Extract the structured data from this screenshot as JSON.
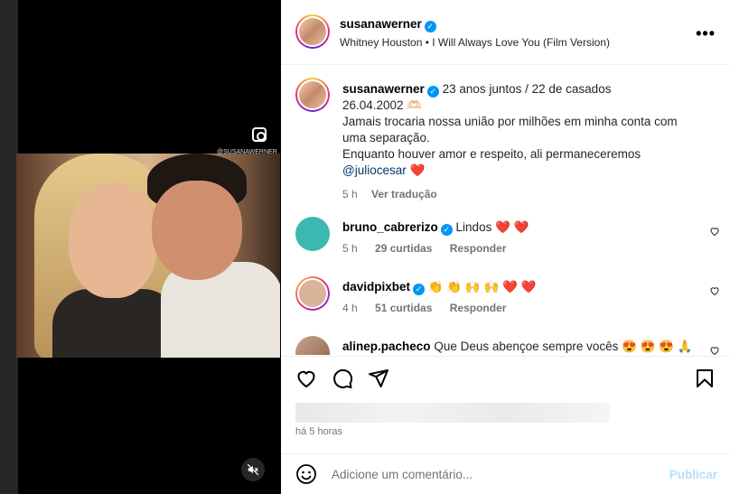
{
  "media": {
    "watermark": "@SUSANAWERNER"
  },
  "header": {
    "username": "susanawerner",
    "audio": "Whitney Houston • I Will Always Love You (Film Version)",
    "more_label": "•••"
  },
  "caption": {
    "username": "susanawerner",
    "line1": "23 anos juntos / 22 de casados",
    "line2": "26.04.2002 🫶🏻",
    "line3": "Jamais trocaria nossa união por milhões em minha conta com uma separação.",
    "line4": "Enquanto houver amor e respeito, ali permaneceremos",
    "mention": "@juliocesar",
    "heart": "❤️",
    "time": "5 h",
    "translate": "Ver tradução"
  },
  "comments": [
    {
      "username": "bruno_cabrerizo",
      "text": "Lindos ❤️ ❤️",
      "time": "5 h",
      "likes": "29 curtidas",
      "reply": "Responder"
    },
    {
      "username": "davidpixbet",
      "text": "👏 👏 🙌 🙌 ❤️ ❤️",
      "time": "4 h",
      "likes": "51 curtidas",
      "reply": "Responder"
    },
    {
      "username": "alinep.pacheco",
      "text": "Que Deus abençoe sempre vocês 😍 😍 😍 🙏"
    }
  ],
  "post": {
    "time_ago": "há 5 horas"
  },
  "comment_box": {
    "placeholder": "Adicione um comentário...",
    "publish": "Publicar"
  },
  "colors": {
    "verified": "#0095f6",
    "mention": "#00376b",
    "heart": "#e41d2c",
    "publish_disabled": "#b2dffc"
  },
  "icons": [
    "instagram-icon",
    "mute-icon",
    "more-icon",
    "heart-icon",
    "comment-icon",
    "share-icon",
    "bookmark-icon",
    "emoji-icon",
    "verified-icon"
  ]
}
